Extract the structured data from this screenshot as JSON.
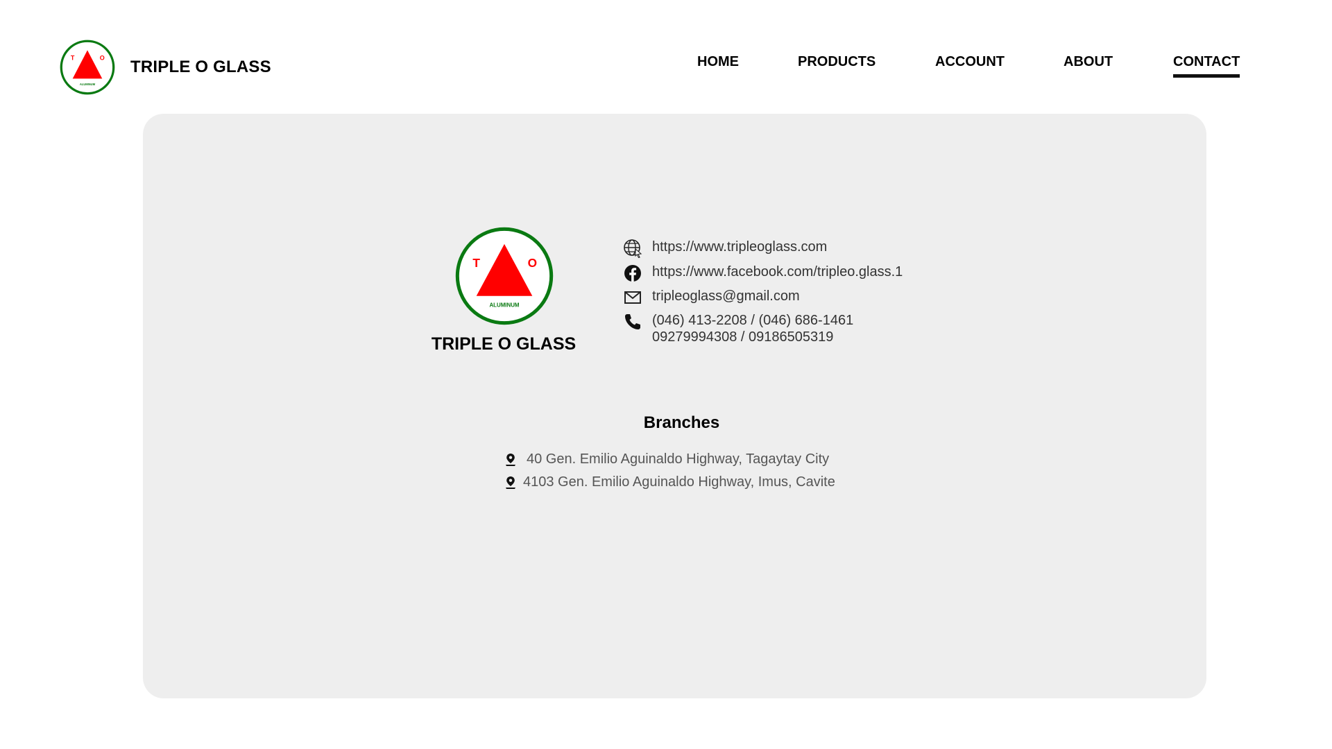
{
  "brand": {
    "name": "TRIPLE O GLASS",
    "logo_letters": {
      "left": "T",
      "right": "O",
      "bottom": "ALUMINUM"
    }
  },
  "nav": {
    "items": [
      {
        "label": "HOME"
      },
      {
        "label": "PRODUCTS"
      },
      {
        "label": "ACCOUNT"
      },
      {
        "label": "ABOUT"
      },
      {
        "label": "CONTACT",
        "active": true
      }
    ]
  },
  "contact": {
    "company_name": "TRIPLE O GLASS",
    "website": "https://www.tripleoglass.com",
    "facebook": "https://www.facebook.com/tripleo.glass.1",
    "email": "tripleoglass@gmail.com",
    "phone_line_1": "(046) 413-2208 / (046) 686-1461",
    "phone_line_2": "09279994308 / 09186505319"
  },
  "branches": {
    "title": "Branches",
    "items": [
      {
        "address": "40 Gen. Emilio Aguinaldo Highway, Tagaytay City"
      },
      {
        "address": "4103 Gen. Emilio Aguinaldo Highway, Imus, Cavite"
      }
    ]
  },
  "colors": {
    "logo_ring": "#0a7a12",
    "logo_triangle": "#ff0000",
    "card_bg": "#eeeeee",
    "text": "#000000",
    "muted_text": "#555555"
  },
  "icons": {
    "website": "globe-cursor-icon",
    "facebook": "facebook-icon",
    "email": "mail-icon",
    "phone": "phone-icon",
    "branch": "map-pin-icon"
  }
}
